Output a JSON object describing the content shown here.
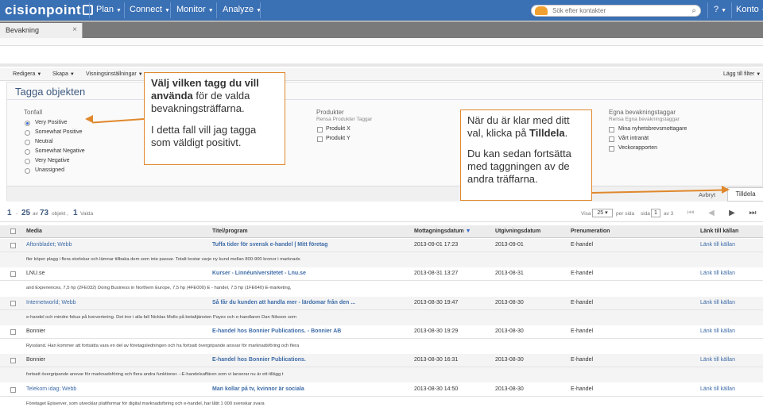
{
  "app": {
    "logo": "cisionpoint",
    "nav": [
      "Plan",
      "Connect",
      "Monitor",
      "Analyze"
    ],
    "search_placeholder": "Sök efter kontakter",
    "help": "?",
    "account": "Konto"
  },
  "tabs": [
    {
      "label": "Bevakning",
      "close": "×"
    }
  ],
  "toolbar": {
    "redigera": "Redigera",
    "skapa": "Skapa",
    "visning": "Visningsinställningar",
    "lagg_till": "Lägg till filter"
  },
  "tag_panel": {
    "title": "Tagga objekten",
    "tonfall": {
      "title": "Tonfall",
      "options": [
        "Very Positive",
        "Somewhat Positive",
        "Neutral",
        "Somewhat Negative",
        "Very Negative",
        "Unassigned"
      ],
      "selected": "Very Positive"
    },
    "produkter": {
      "title": "Produkter",
      "subtitle": "Rensa Produkter Taggar",
      "options": [
        "Produkt X",
        "Produkt Y"
      ]
    },
    "egna": {
      "title": "Egna bevakningstaggar",
      "subtitle": "Rensa Egna bevakningstaggar",
      "options": [
        "Mina nyhetsbrevsmottagare",
        "Vårt intranät",
        "Veckorapporten"
      ]
    },
    "cancel": "Avbryt",
    "assign": "Tilldela"
  },
  "callouts": {
    "left_bold": "Välj vilken tagg du vill använda",
    "left_rest": " för de valda bevakningsträffarna.",
    "left_second": "I detta fall vill jag tagga som väldigt positivt.",
    "right_first_pre": "När du är klar med ditt val, klicka på ",
    "right_first_bold": "Tilldela",
    "right_first_post": ".",
    "right_second": "Du kan sedan fortsätta med taggningen av de andra träffarna."
  },
  "pager": {
    "from": "1",
    "dash": "-",
    "to": "25",
    "av": "av",
    "total": "73",
    "objekt": "objekt ,",
    "selected": "1",
    "valda": "Valda",
    "visa": "Visa",
    "per_page": "25",
    "per_sida": "per sida",
    "sida": "sida",
    "page": "1",
    "av_pages": "av 3"
  },
  "table": {
    "headers": [
      "Media",
      "Titel/program",
      "Mottagningsdatum",
      "Utgivningsdatum",
      "Prenumeration",
      "Länk till källan"
    ],
    "rows": [
      {
        "media": "Aftonbladet; Webb",
        "media_link": true,
        "title": "Tuffa tider för svensk e-handel | Mitt företag",
        "received": "2013-09-01 17:23",
        "published": "2013-09-01",
        "sub": "E-handel",
        "link": "Länk till källan",
        "snippet": "fler köper plagg i flera storlekar och lämnar tillbaka dem som inte passar. Totalt kostar varje ny kund mellan 800-900 kronor i marknads"
      },
      {
        "media": "LNU.se",
        "media_link": false,
        "title": "Kurser - Linnéuniversitetet - Lnu.se",
        "received": "2013-08-31 13:27",
        "published": "2013-08-31",
        "sub": "E-handel",
        "link": "Länk till källan",
        "snippet": "and Experiences, 7,5 hp (2FE032) Doing Business in Northern Europe, 7,5 hp (4FE000) E - handel, 7,5 hp (1FE640) E-marketing,"
      },
      {
        "media": "Internetworld; Webb",
        "media_link": true,
        "title": "Så får du kunden att handla mer - lärdomar från den ...",
        "received": "2013-08-30 19:47",
        "published": "2013-08-30",
        "sub": "E-handel",
        "link": "Länk till källan",
        "snippet": "e-handel och mindre fokus på konvertering. Det tror i alla fall Nicklas Mollo på betaltjänsten Payex och e-handlaren Dan Nilsson som"
      },
      {
        "media": "Bonnier",
        "media_link": false,
        "title": "E-handel hos Bonnier Publications. - Bonnier AB",
        "received": "2013-08-30 19:29",
        "published": "2013-08-30",
        "sub": "E-handel",
        "link": "Länk till källan",
        "snippet": "Ryssland. Han kommer att fortsätta vara en del av företagsledningen och ha fortsatt övergripande ansvar för marknadsföring och flera"
      },
      {
        "media": "Bonnier",
        "media_link": false,
        "title": "E-handel hos Bonnier Publications.",
        "received": "2013-08-30 16:31",
        "published": "2013-08-30",
        "sub": "E-handel",
        "link": "Länk till källan",
        "snippet": "fortsatt övergripande ansvar för marknadsföring och flera andra funktioner. –E-handelsaffären som vi lanserar nu är ett tillägg t"
      },
      {
        "media": "Telekom idag; Webb",
        "media_link": true,
        "title": "Man kollar på tv, kvinnor är sociala",
        "received": "2013-08-30 14:50",
        "published": "2013-08-30",
        "sub": "E-handel",
        "link": "Länk till källan",
        "snippet": "Företaget Episerver, som utvecklar plattformar för digital marknadsföring och e-handel, har låtit 1 000 svenskar svara"
      }
    ]
  },
  "colors": {
    "nav_bg": "#3a70b4",
    "accent": "#e0882c",
    "link": "#3e6ca8"
  }
}
